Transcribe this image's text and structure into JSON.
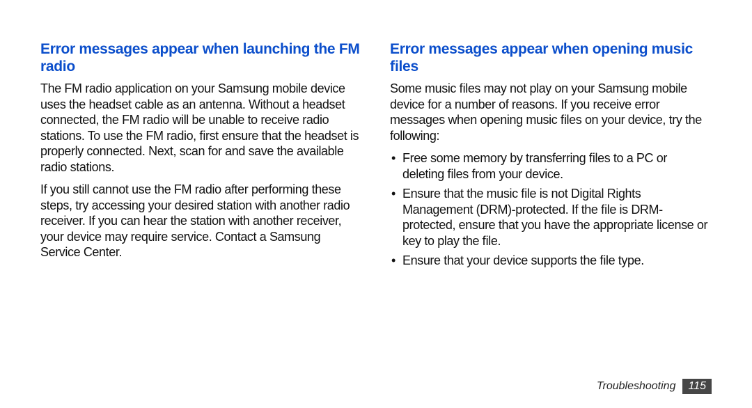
{
  "left": {
    "heading": "Error messages appear when launching the FM radio",
    "p1": "The FM radio application on your Samsung mobile device uses the headset cable as an antenna. Without a headset connected, the FM radio will be unable to receive radio stations. To use the FM radio, ﬁrst ensure that the headset is properly connected. Next, scan for and save the available radio stations.",
    "p2": "If you still cannot use the FM radio after performing these steps, try accessing your desired station with another radio receiver. If you can hear the station with another receiver, your device may require service. Contact a Samsung Service Center."
  },
  "right": {
    "heading": "Error messages appear when opening music ﬁles",
    "p1": "Some music ﬁles may not play on your Samsung mobile device for a number of reasons. If you receive error messages when opening music ﬁles on your device, try the following:",
    "bullets": [
      "Free some memory by transferring ﬁles to a PC or deleting ﬁles from your device.",
      "Ensure that the music ﬁle is not Digital Rights Management (DRM)-protected. If the ﬁle is DRM-protected, ensure that you have the appropriate license or key to play the ﬁle.",
      "Ensure that your device supports the ﬁle type."
    ]
  },
  "footer": {
    "section": "Troubleshooting",
    "page": "115"
  }
}
